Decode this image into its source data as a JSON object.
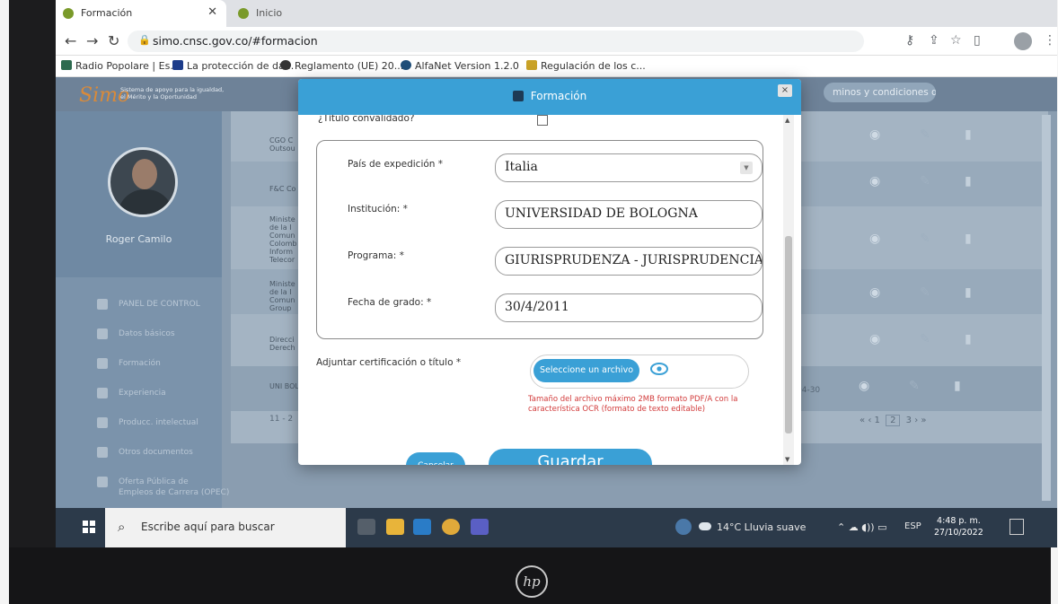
{
  "browser": {
    "tab_active": "Formación",
    "tab_inactive": "Inicio",
    "url": "simo.cnsc.gov.co/#formacion",
    "bookmarks": [
      {
        "label": "Radio Popolare | Es...",
        "color": "#2d6a4f"
      },
      {
        "label": "La protección de da...",
        "color": "#1d3c8a"
      },
      {
        "label": "Reglamento (UE) 20...",
        "color": "#333333"
      },
      {
        "label": "AlfaNet Version 1.2.0",
        "color": "#1f4e79"
      },
      {
        "label": "Regulación de los c...",
        "color": "#c9a227"
      }
    ]
  },
  "app": {
    "logo": "Simo",
    "logo_subtitle": "Sistema de apoyo para la igualdad, el Mérito y la Oportunidad",
    "terms_link": "minos y condiciones de uso",
    "user_name": "Roger Camilo",
    "menu": [
      "PANEL DE CONTROL",
      "Datos básicos",
      "Formación",
      "Experiencia",
      "Producc. intelectual",
      "Otros documentos",
      "Oferta Pública de",
      "Empleos de Carrera (OPEC)"
    ],
    "rows": [
      {
        "text": "CGO C Outsou"
      },
      {
        "text": "F&C Co"
      },
      {
        "text": "Ministe de la I Comun Colomb Inform Telecor"
      },
      {
        "text": "Ministe de la I Comun Group"
      },
      {
        "text": "Direcci Derech"
      },
      {
        "text": "UNI BOL"
      }
    ],
    "row_date_snippet": "04-30",
    "count_snippet": "11 - 2",
    "pagination": {
      "prev_all": "«",
      "prev": "‹",
      "pages": [
        "1",
        "2",
        "3"
      ],
      "current": "2",
      "next": "›",
      "next_all": "»"
    }
  },
  "modal": {
    "title": "Formación",
    "close": "×",
    "titulo_convalidado": "¿Título convalidado?",
    "fields": [
      {
        "label": "País de expedición *",
        "value": "Italia",
        "dropdown": true
      },
      {
        "label": "Institución: *",
        "value": "UNIVERSIDAD DE BOLOGNA"
      },
      {
        "label": "Programa: *",
        "value": "GIURISPRUDENZA - JURISPRUDENCIA"
      },
      {
        "label": "Fecha de grado: *",
        "value": "30/4/2011"
      }
    ],
    "attach_label": "Adjuntar certificación o título *",
    "file_button": "Seleccione un archivo",
    "hint": "Tamaño del archivo máximo 2MB formato PDF/A con la característica OCR (formato de texto editable)",
    "cancel": "Cancelar",
    "save": "Guardar"
  },
  "taskbar": {
    "search_placeholder": "Escribe aquí para buscar",
    "weather": "14°C  Lluvia suave",
    "lang": "ESP",
    "time": "4:48 p. m.",
    "date": "27/10/2022"
  },
  "laptop_brand": "hp",
  "colors": {
    "accent": "#3aa0d6",
    "error": "#d23b3b",
    "header": "#6e8298"
  }
}
